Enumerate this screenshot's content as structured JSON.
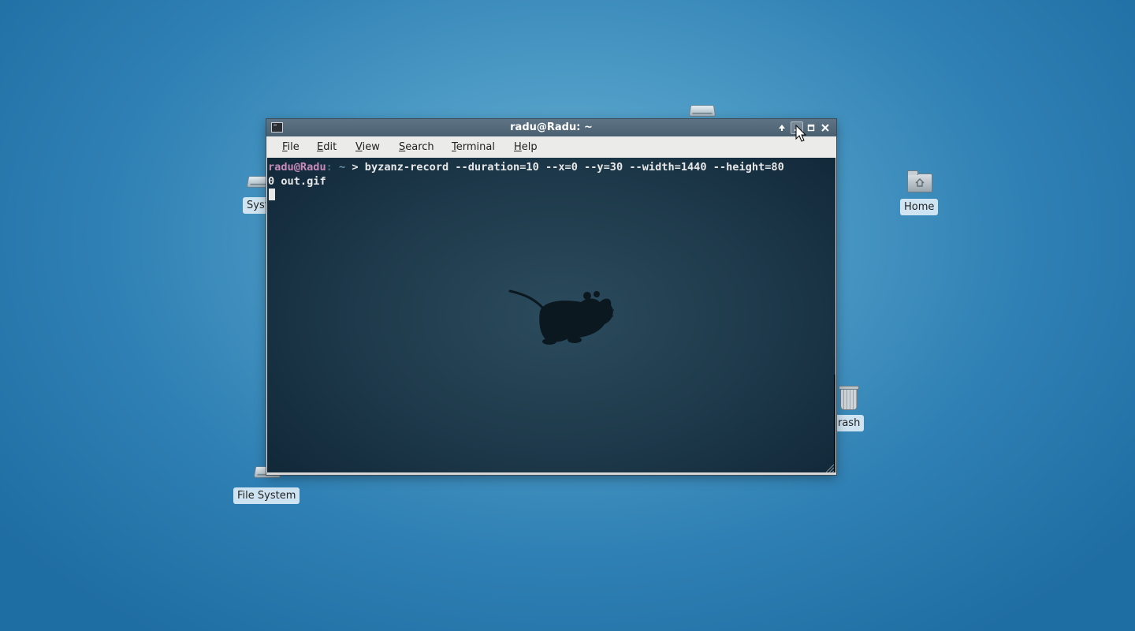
{
  "desktop": {
    "icons": [
      {
        "name": "Home",
        "type": "folder-home-icon"
      },
      {
        "name": "Trash",
        "type": "trash-icon"
      },
      {
        "name": "File System",
        "type": "drive-icon"
      },
      {
        "name": "System",
        "type": "drive-icon"
      }
    ],
    "partial_labels": {
      "system": "Syst",
      "trash": "rash"
    }
  },
  "window": {
    "title": "radu@Radu: ~",
    "buttons": [
      "arrow-up-icon",
      "minimize-icon",
      "maximize-icon",
      "close-icon"
    ]
  },
  "menubar": {
    "items": [
      {
        "label": "File",
        "mnemonic": "F",
        "rest": "ile"
      },
      {
        "label": "Edit",
        "mnemonic": "E",
        "rest": "dit"
      },
      {
        "label": "View",
        "mnemonic": "V",
        "rest": "iew"
      },
      {
        "label": "Search",
        "mnemonic": "S",
        "rest": "earch"
      },
      {
        "label": "Terminal",
        "mnemonic": "T",
        "rest": "erminal"
      },
      {
        "label": "Help",
        "mnemonic": "H",
        "rest": "elp"
      }
    ]
  },
  "terminal": {
    "prompt_user": "radu@Radu",
    "prompt_sep": ":",
    "prompt_dir": "~",
    "prompt_symbol": ">",
    "command_line1": "byzanz-record --duration=10 --x=0 --y=30 --width=1440 --height=80",
    "command_line2": "0 out.gif"
  },
  "colors": {
    "prompt_user": "#c88ab8",
    "titlebar": "#546a7c",
    "desktop": "#2f80b4"
  }
}
